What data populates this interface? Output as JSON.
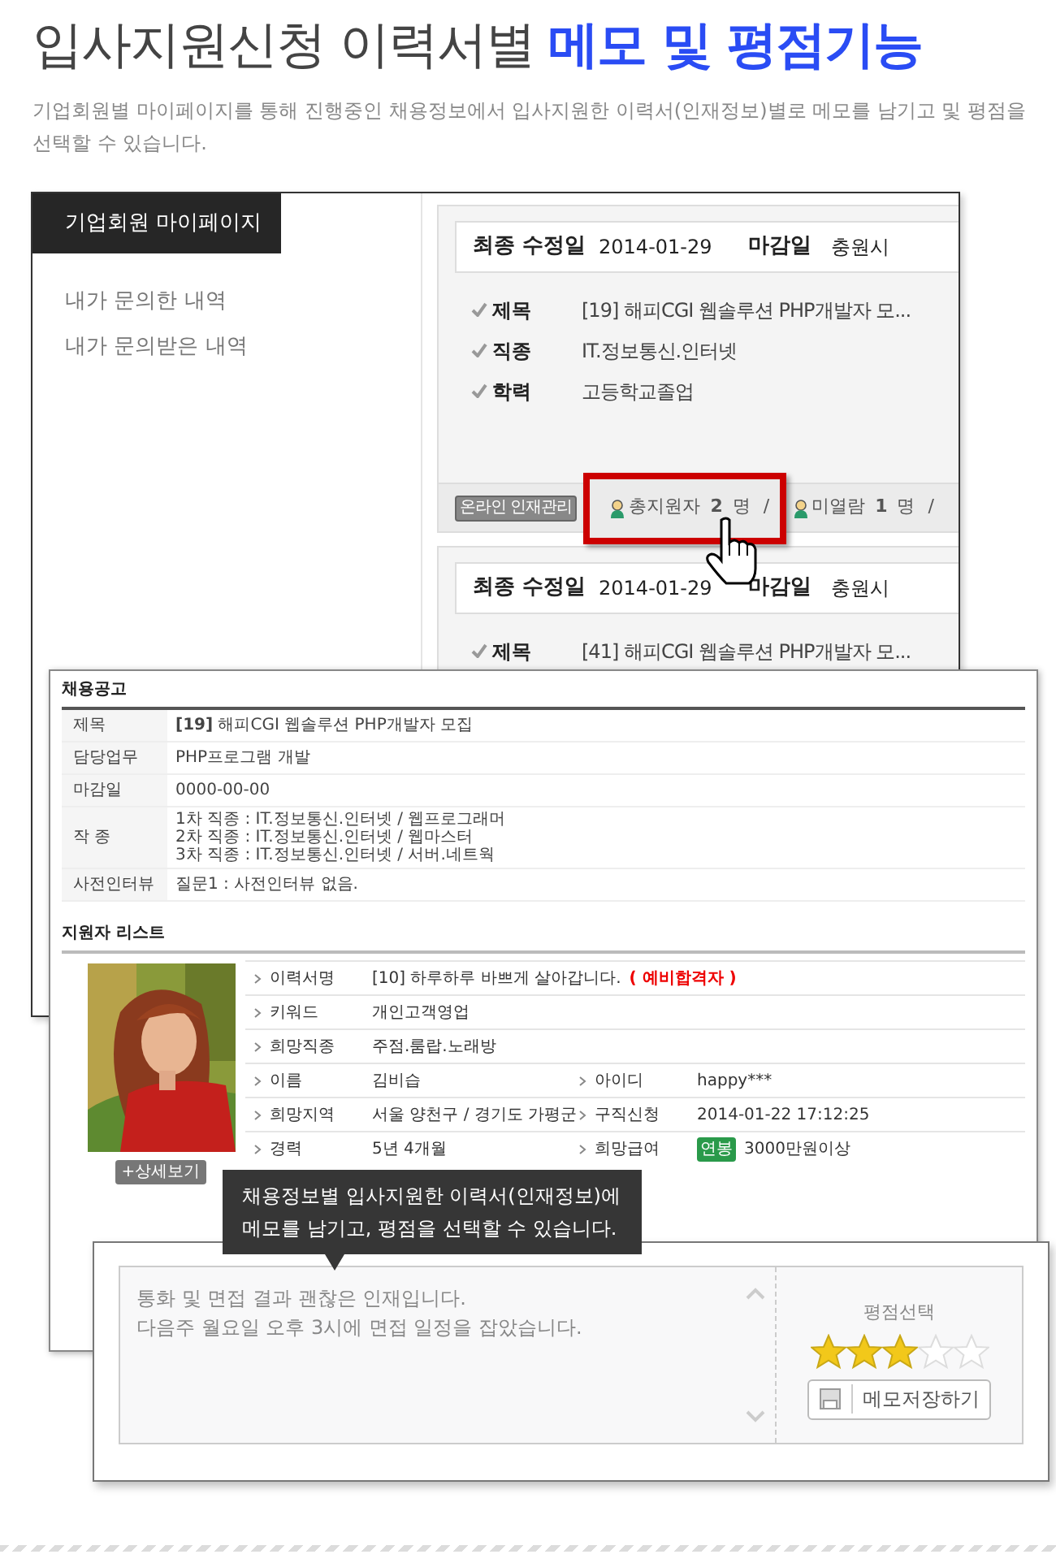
{
  "heading": {
    "plain": "입사지원신청 이력서별",
    "highlight": "메모 및 평점기능"
  },
  "intro": "기업회원별 마이페이지를 통해 진행중인 채용정보에서 입사지원한 이력서(인재정보)별로 메모를 남기고 및 평점을 선택할 수 있습니다.",
  "mypage": {
    "tab": "기업회원 마이페이지",
    "menu": [
      {
        "label": "내가 문의한 내역"
      },
      {
        "label": "내가 문의받은 내역"
      }
    ],
    "postings": [
      {
        "modified_label": "최종 수정일",
        "modified": "2014-01-29",
        "deadline_label": "마감일",
        "deadline": "충원시",
        "fields": [
          {
            "label": "제목",
            "value": "[19] 해피CGI 웹솔루션 PHP개발자 모..."
          },
          {
            "label": "직종",
            "value": "IT.정보통신.인터넷"
          },
          {
            "label": "학력",
            "value": "고등학교졸업"
          }
        ],
        "footer": {
          "badge": "온라인 인재관리",
          "stats": [
            {
              "label": "총지원자",
              "count": "2",
              "unit": "명",
              "separator": "/",
              "highlighted": true
            },
            {
              "label": "미열람",
              "count": "1",
              "unit": "명",
              "separator": "/",
              "highlighted": false
            }
          ]
        }
      },
      {
        "modified_label": "최종 수정일",
        "modified": "2014-01-29",
        "deadline_label": "마감일",
        "deadline": "충원시",
        "fields": [
          {
            "label": "제목",
            "value": "[41] 해피CGI 웹솔루션 PHP개발자 모..."
          }
        ]
      }
    ]
  },
  "posting": {
    "title": "채용공고",
    "rows": [
      {
        "label": "제목",
        "lines": [
          "**[19]** 해피CGI 웹솔루션 PHP개발자 모집"
        ]
      },
      {
        "label": "담당업무",
        "lines": [
          "PHP프로그램 개발"
        ]
      },
      {
        "label": "마감일",
        "lines": [
          "0000-00-00"
        ]
      },
      {
        "label": "작 종",
        "lines": [
          "1차 직종 : IT.정보통신.인터넷 / 웹프로그래머",
          "2차 직종 : IT.정보통신.인터넷 / 웹마스터",
          "3차 직종 : IT.정보통신.인터넷 / 서버.네트웍"
        ]
      },
      {
        "label": "사전인터뷰",
        "lines": [
          "질문1 : 사전인터뷰 없음."
        ]
      }
    ]
  },
  "applicants": {
    "title": "지원자 리스트",
    "photo": {
      "kind": "picture"
    },
    "detail_button": "+상세보기",
    "rows": [
      [
        {
          "label": "이력서명",
          "value": "[10] 하루하루 바쁘게 살아갑니다.",
          "tag": "( 예비합격자 )"
        }
      ],
      [
        {
          "label": "키워드",
          "value": "개인고객영업"
        }
      ],
      [
        {
          "label": "희망직종",
          "value": "주점.룸랍.노래방"
        }
      ],
      [
        {
          "label": "이름",
          "value": "김비습"
        },
        {
          "label": "아이디",
          "value": "happy***"
        }
      ],
      [
        {
          "label": "희망지역",
          "value": "서울 양천구 / 경기도 가평군"
        },
        {
          "label": "구직신청",
          "value": "2014-01-22 17:12:25"
        }
      ],
      [
        {
          "label": "경력",
          "value": "5년 4개월"
        },
        {
          "label": "희망급여",
          "badge": "연봉",
          "value": "3000만원이상"
        }
      ]
    ]
  },
  "tooltip": {
    "lines": [
      "채용정보별 입사지원한 이력서(인재정보)에",
      "메모를 남기고, 평점을 선택할 수 있습니다."
    ]
  },
  "memo": {
    "note_lines": [
      "통화 및 면접 결과 괜찮은 인재입니다.",
      "다음주 월요일 오후 3시에 면접 일정을 잡았습니다."
    ],
    "rating_label": "평점선택",
    "stars": 3,
    "save_button": "메모저장하기"
  }
}
